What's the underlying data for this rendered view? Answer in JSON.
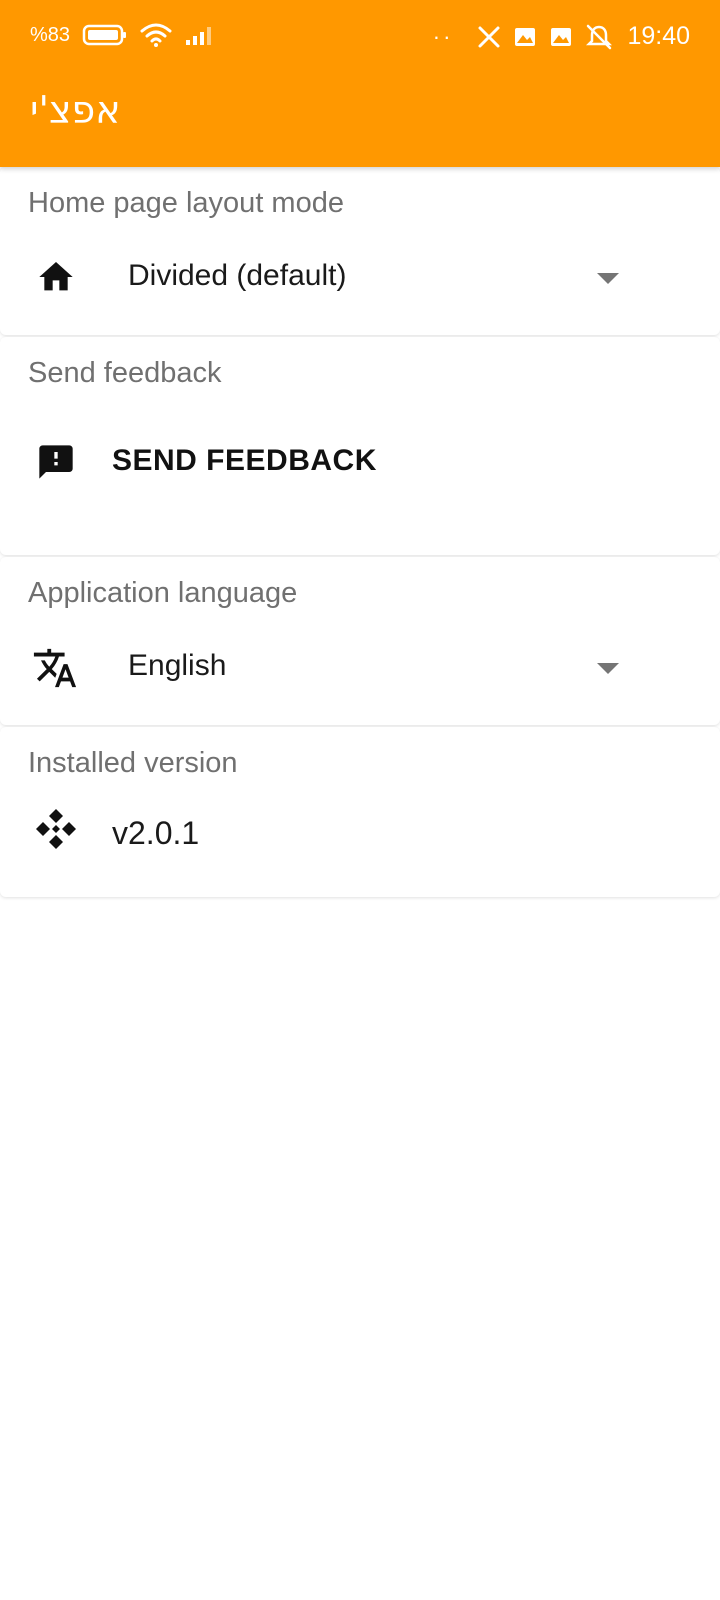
{
  "status_bar": {
    "battery_percent": "%83",
    "time": "19:40",
    "overflow_dots": "··",
    "icons": [
      "battery-icon",
      "wifi-icon",
      "signal-icon",
      "x-app-icon",
      "image-notification-icon",
      "image-notification-icon",
      "vibrate-off-icon"
    ]
  },
  "app_bar": {
    "title": "אפצ'י",
    "background_color": "#FF9800"
  },
  "settings": {
    "layout_mode": {
      "label": "Home page layout mode",
      "value": "Divided (default)",
      "icon": "home-icon"
    },
    "feedback": {
      "label": "Send feedback",
      "button_label": "SEND FEEDBACK",
      "icon": "feedback-icon"
    },
    "language": {
      "label": "Application language",
      "value": "English",
      "icon": "translate-icon"
    },
    "version": {
      "label": "Installed version",
      "value": "v2.0.1",
      "icon": "diamonds-icon"
    }
  }
}
